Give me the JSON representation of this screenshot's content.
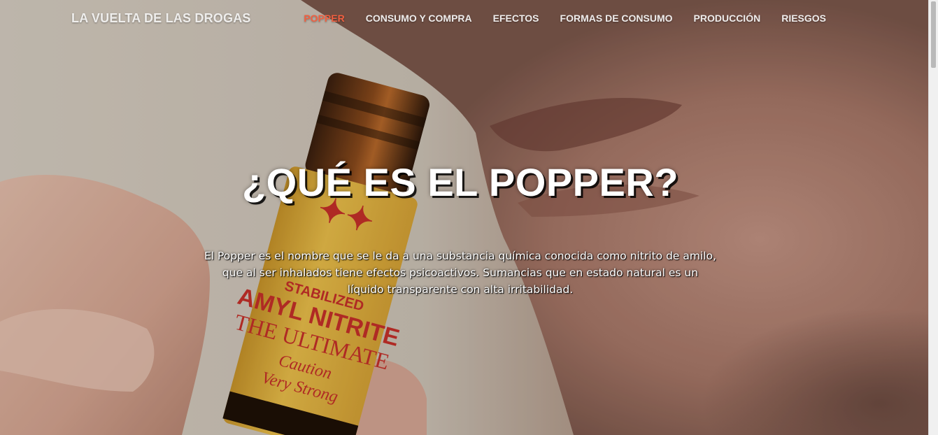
{
  "site": {
    "brand": "LA VUELTA DE LAS DROGAS"
  },
  "nav": {
    "items": [
      {
        "label": "POPPER",
        "active": true
      },
      {
        "label": "CONSUMO Y COMPRA",
        "active": false
      },
      {
        "label": "EFECTOS",
        "active": false
      },
      {
        "label": "FORMAS DE CONSUMO",
        "active": false
      },
      {
        "label": "PRODUCCIÓN",
        "active": false
      },
      {
        "label": "RIESGOS",
        "active": false
      }
    ]
  },
  "hero": {
    "title": "¿QUÉ ES EL POPPER?",
    "text": "El Popper es el nombre que se le da a una substancia química conocida como nitrito de amilo, que al ser inhalados tiene efectos psicoactivos. Sumancias que en estado natural es un líquido transparente con alta irritabilidad."
  },
  "bottle_label": {
    "line1": "STABILIZED",
    "line2": "AMYL NITRITE",
    "line3": "THE ULTIMATE",
    "line4": "Caution",
    "line5": "Very Strong"
  },
  "colors": {
    "accent": "#f05f40",
    "label_yellow": "#e8b830",
    "label_red": "#c8302a"
  }
}
